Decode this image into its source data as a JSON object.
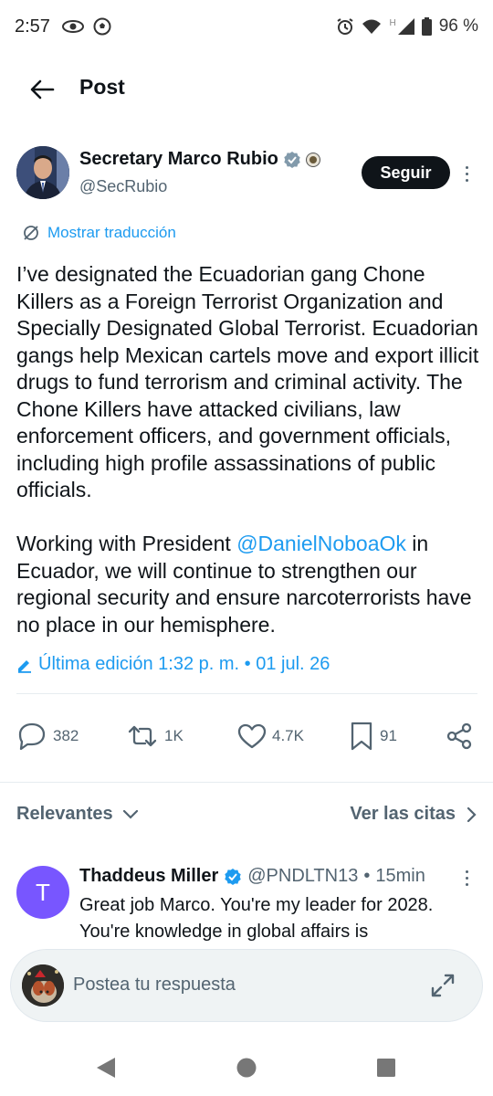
{
  "status_bar": {
    "time": "2:57",
    "battery": "96 %",
    "signal_label": "H"
  },
  "header": {
    "title": "Post"
  },
  "post": {
    "author_name": "Secretary Marco Rubio",
    "author_handle": "@SecRubio",
    "follow_label": "Seguir",
    "translate_label": "Mostrar traducción",
    "paragraph1": "I’ve designated the Ecuadorian gang Chone Killers as a Foreign Terrorist Organization and Specially Designated Global Terrorist. Ecuadorian gangs help Mexican cartels move and export illicit drugs to fund terrorism and criminal activity. The Chone Killers have attacked civilians, law enforcement officers, and government officials, including high profile assassinations of public officials.",
    "paragraph2_before": "Working with President ",
    "paragraph2_mention": "@DanielNoboaOk",
    "paragraph2_after": " in Ecuador, we will continue to strengthen our regional security and ensure narcoterrorists have no place in our hemisphere.",
    "edited_label": "Última edición 1:32 p. m. • 01 jul. 26"
  },
  "actions": {
    "replies": "382",
    "reposts": "1K",
    "likes": "4.7K",
    "bookmarks": "91"
  },
  "sort": {
    "left_label": "Relevantes",
    "right_label": "Ver las citas"
  },
  "reply": {
    "avatar_letter": "T",
    "name": "Thaddeus Miller",
    "handle": "@PNDLTN13",
    "time": "15min",
    "text": "Great job Marco.  You're my leader for 2028. You're knowledge in global affairs is"
  },
  "composer": {
    "placeholder": "Postea tu respuesta"
  },
  "colors": {
    "accent": "#1d9bf0",
    "text": "#0f1419",
    "muted": "#536471",
    "verified": "#1d9bf0",
    "reply_avatar": "#7856ff"
  }
}
